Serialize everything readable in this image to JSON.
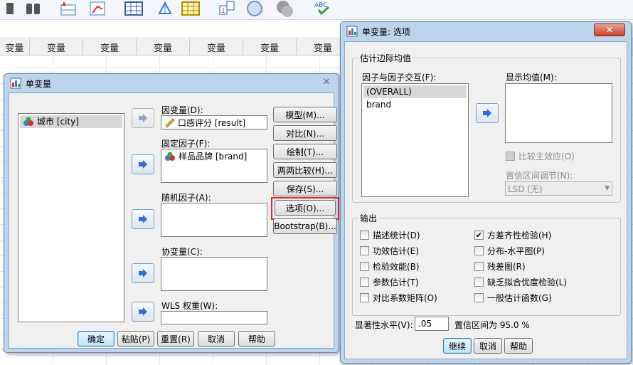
{
  "editor": {
    "column_headers": [
      "变量",
      "变量",
      "变量",
      "变量",
      "变量",
      "变量",
      "变量"
    ]
  },
  "univariate": {
    "title": "单变量",
    "source_list": [
      {
        "label": "城市 [city]"
      }
    ],
    "dependent": {
      "label": "因变量(D):",
      "value": "口感评分 [result]"
    },
    "fixed_factors": {
      "label": "固定因子(F):",
      "items": [
        {
          "label": "样品品牌 [brand]"
        }
      ]
    },
    "random_factors": {
      "label": "随机因子(A):"
    },
    "covariates": {
      "label": "协变量(C):"
    },
    "wls": {
      "label": "WLS 权重(W):"
    },
    "side_buttons": {
      "model": "模型(M)...",
      "contrasts": "对比(N)...",
      "plots": "绘制(T)...",
      "posthoc": "两两比较(H)...",
      "save": "保存(S)...",
      "options": "选项(O)...",
      "bootstrap": "Bootstrap(B)..."
    },
    "bottom_buttons": {
      "ok": "确定",
      "paste": "粘贴(P)",
      "reset": "重置(R)",
      "cancel": "取消",
      "help": "帮助"
    }
  },
  "options": {
    "title": "单变量: 选项",
    "emm_group_title": "估计边际均值",
    "factors_label": "因子与因子交互(F):",
    "factors": [
      {
        "label": "(OVERALL)",
        "selected": true
      },
      {
        "label": "brand",
        "selected": false
      }
    ],
    "display_means_label": "显示均值(M):",
    "compare_main_effects": "比较主效应(O)",
    "ci_adjust_label": "置信区间调节(N):",
    "ci_adjust_value": "LSD (无)",
    "output_group_title": "输出",
    "output_checks": [
      {
        "label": "描述统计(D)",
        "checked": false
      },
      {
        "label": "方差齐性检验(H)",
        "checked": true
      },
      {
        "label": "功效估计(E)",
        "checked": false
      },
      {
        "label": "分布-水平图(P)",
        "checked": false
      },
      {
        "label": "检验效能(B)",
        "checked": false
      },
      {
        "label": "残差图(R)",
        "checked": false
      },
      {
        "label": "参数估计(T)",
        "checked": false
      },
      {
        "label": "缺乏拟合优度检验(L)",
        "checked": false
      },
      {
        "label": "对比系数矩阵(O)",
        "checked": false
      },
      {
        "label": "一般估计函数(G)",
        "checked": false
      }
    ],
    "sig_level_label": "显著性水平(V):",
    "sig_level_value": ".05",
    "ci_text": "置信区间为 95.0 %",
    "buttons": {
      "continue": "继续",
      "cancel": "取消",
      "help": "帮助"
    }
  },
  "colors": {
    "highlight_red": "#d62e2e",
    "arrow_blue": "#2f6fd0",
    "dialog_frame": "#bcd4ec"
  }
}
